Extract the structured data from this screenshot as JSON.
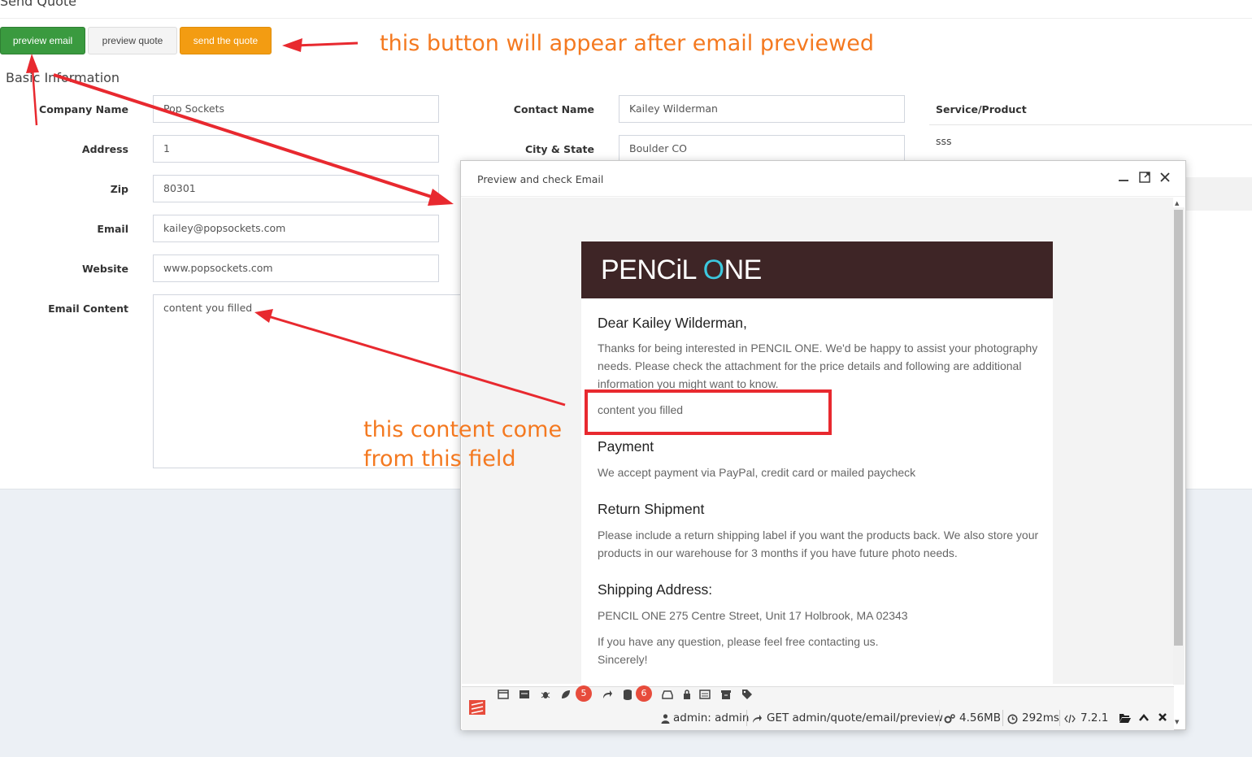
{
  "page": {
    "title": "Send Quote"
  },
  "toolbar": {
    "preview_email": "preview email",
    "preview_quote": "preview quote",
    "send_quote": "send the quote"
  },
  "section": {
    "title": "Basic Information"
  },
  "form": {
    "company_label": "Company Name",
    "company_value": "Pop Sockets",
    "address_label": "Address",
    "address_value": "1",
    "zip_label": "Zip",
    "zip_value": "80301",
    "email_label": "Email",
    "email_value": "kailey@popsockets.com",
    "website_label": "Website",
    "website_value": "www.popsockets.com",
    "content_label": "Email Content",
    "content_value": "content you filled",
    "contact_label": "Contact Name",
    "contact_value": "Kailey  Wilderman",
    "city_label": "City & State",
    "city_value": "Boulder  CO"
  },
  "service": {
    "header": "Service/Product",
    "value": "sss"
  },
  "modal": {
    "title": "Preview and check Email",
    "email": {
      "logo_a": "PENCiL ",
      "logo_b": "O",
      "logo_c": "NE",
      "greeting": "Dear Kailey Wilderman,",
      "intro": "Thanks for being interested in PENCIL ONE. We'd be happy to assist your photography needs. Please check the attachment for the price details and following are additional information you might want to know.",
      "custom": "content you filled",
      "payment_h": "Payment",
      "payment_p": "We accept payment via PayPal, credit card or mailed paycheck",
      "return_h": "Return Shipment",
      "return_p": "Please include a return shipping label if you want the products back. We also store your products in our warehouse for 3 months if you have future photo needs.",
      "ship_h": "Shipping Address:",
      "ship_p": "PENCIL ONE 275 Centre Street, Unit 17 Holbrook, MA 02343",
      "closing_1": "If you have any question, please feel free contacting us.",
      "closing_2": "Sincerely!"
    }
  },
  "debugbar": {
    "badge_logs": "5",
    "badge_queries": "6",
    "user": "admin: admin",
    "route": "GET admin/quote/email/preview",
    "memory": "4.56MB",
    "time": "292ms",
    "version": "7.2.1"
  },
  "annotations": {
    "button_note": "this button will appear after email previewed",
    "content_note_1": "this content come",
    "content_note_2": "from this field"
  },
  "colors": {
    "brand_green": "#3a9a3f",
    "brand_orange": "#f39c12",
    "annotation": "#f47920",
    "annotation_red": "#e8292f",
    "email_header": "#3e2526",
    "logo_accent": "#3cc8de"
  }
}
